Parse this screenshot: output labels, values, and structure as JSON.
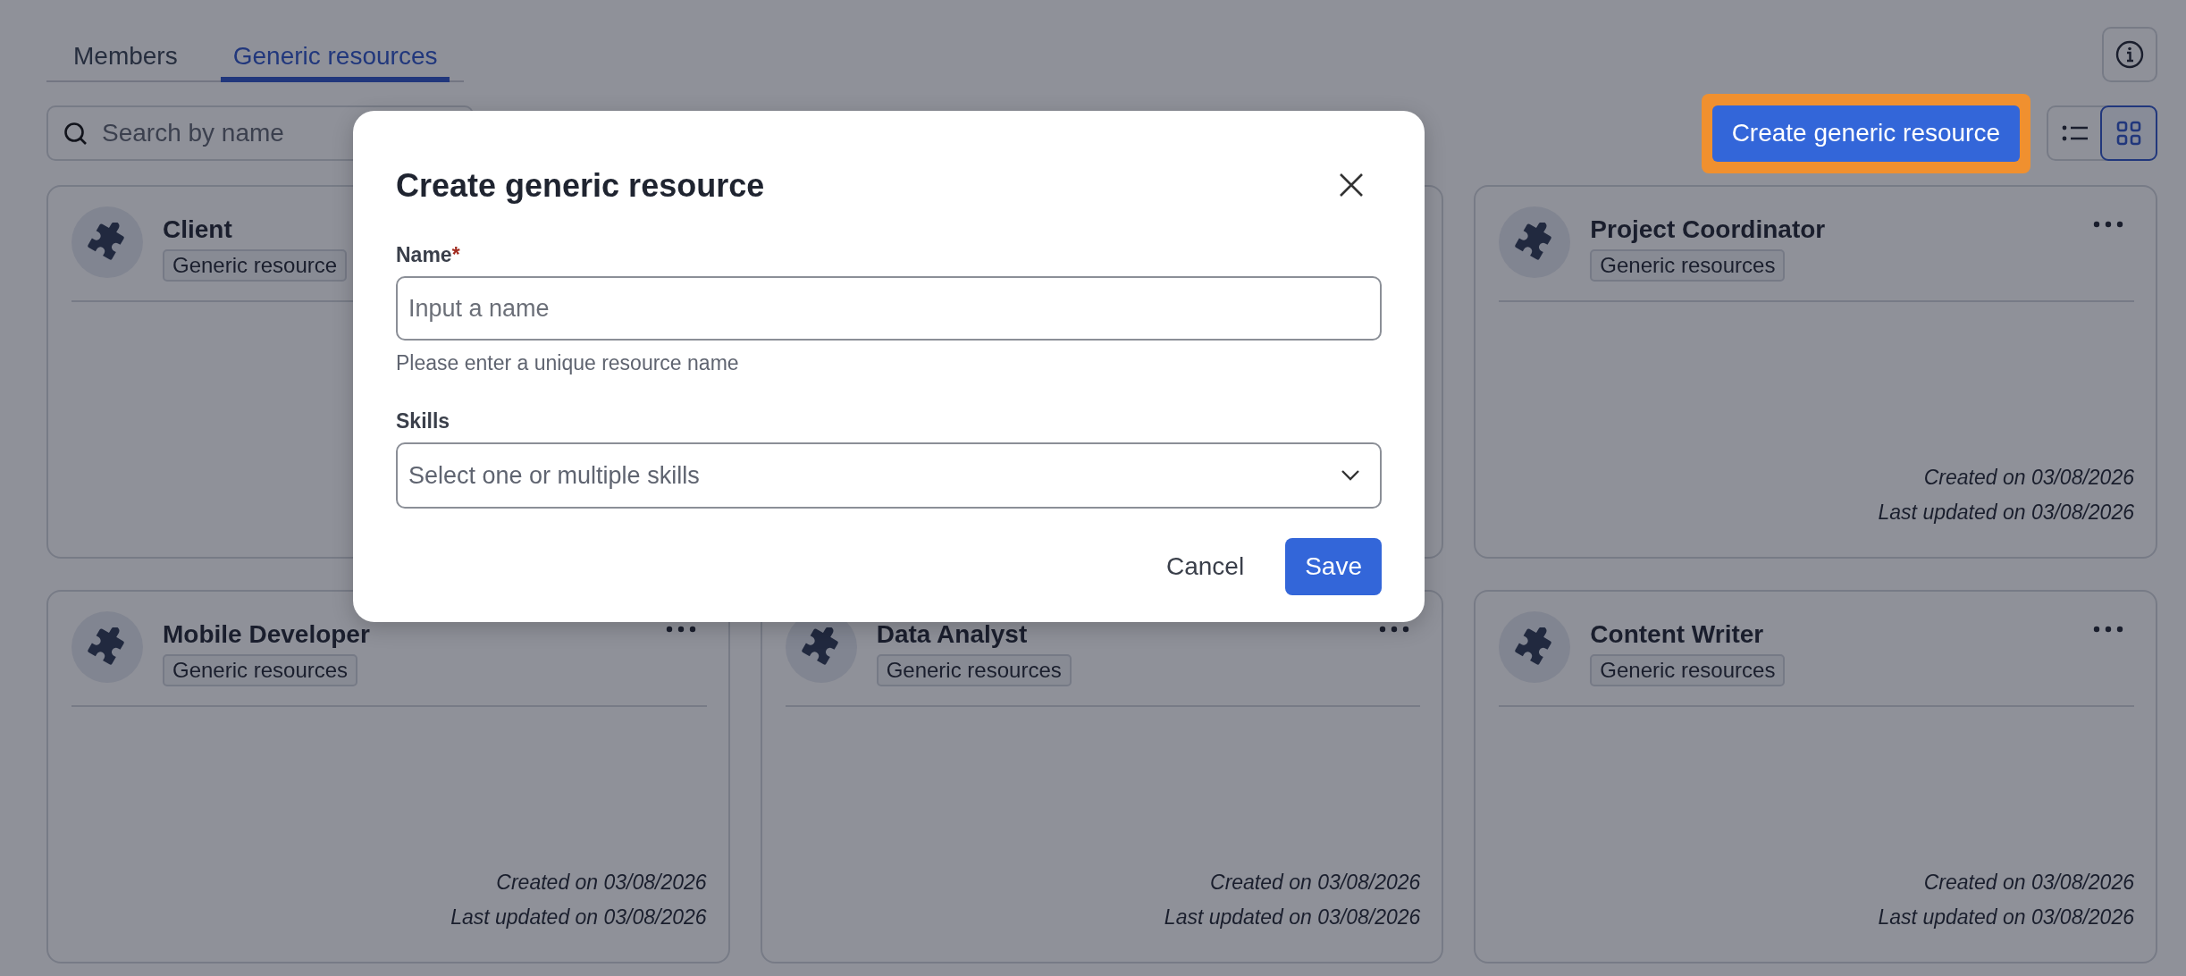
{
  "tabs": [
    {
      "label": "Members",
      "selected": false
    },
    {
      "label": "Generic resources",
      "selected": true
    }
  ],
  "search": {
    "placeholder": "Search by name"
  },
  "create_button": {
    "label": "Create generic resource",
    "highlighted": true
  },
  "view_toggle": [
    {
      "kind": "list",
      "selected": false
    },
    {
      "kind": "grid",
      "selected": true
    }
  ],
  "cards": [
    {
      "kind": "resource",
      "title": "Client",
      "tag": "Generic resource"
    },
    {
      "kind": "covered"
    },
    {
      "kind": "resource",
      "title": "Project Coordinator",
      "tag": "Generic resources",
      "created": "Created on 03/08/2026",
      "updated": "Last updated on 03/08/2026",
      "menu": true
    },
    {
      "kind": "resource",
      "title": "Mobile Developer",
      "tag": "Generic resources",
      "created": "Created on 03/08/2026",
      "updated": "Last updated on 03/08/2026",
      "menu": true
    },
    {
      "kind": "resource",
      "title": "Data Analyst",
      "tag": "Generic resources",
      "created": "Created on 03/08/2026",
      "updated": "Last updated on 03/08/2026",
      "menu": true
    },
    {
      "kind": "resource",
      "title": "Content Writer",
      "tag": "Generic resources",
      "created": "Created on 03/08/2026",
      "updated": "Last updated on 03/08/2026",
      "menu": true
    }
  ],
  "dialog": {
    "open": true,
    "title": "Create generic resource",
    "name_field": {
      "label": "Name",
      "required_mark": "*",
      "placeholder": "Input a name",
      "hint": "Please enter a unique resource name"
    },
    "skills_field": {
      "label": "Skills",
      "placeholder": "Select one or multiple skills"
    },
    "buttons": [
      {
        "kind": "secondary",
        "label": "Cancel"
      },
      {
        "kind": "primary",
        "label": "Save"
      }
    ]
  }
}
